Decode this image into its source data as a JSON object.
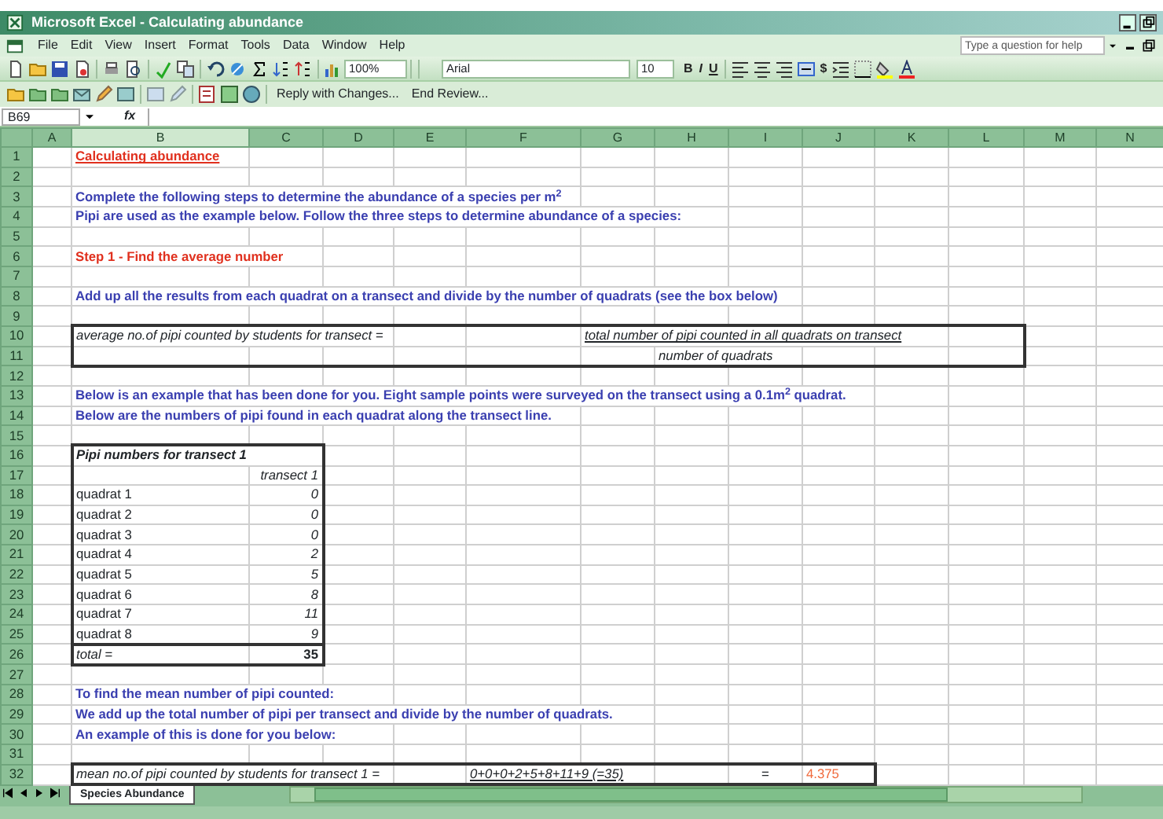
{
  "window": {
    "title": "Microsoft Excel - Calculating abundance"
  },
  "menu": [
    "File",
    "Edit",
    "View",
    "Insert",
    "Format",
    "Tools",
    "Data",
    "Window",
    "Help"
  ],
  "help_box": {
    "placeholder": "Type a question for help"
  },
  "toolbar": {
    "zoom": "100%",
    "font": "Arial",
    "font_size": "10",
    "bold_key": "B",
    "italic_key": "I",
    "underline_key": "U",
    "currency_key": "$"
  },
  "review_toolbar": {
    "reply": "Reply with Changes...",
    "end_review": "End Review..."
  },
  "formula_bar": {
    "name_box": "B69",
    "function_key": "fx"
  },
  "columns": [
    {
      "label": "A",
      "selected": false
    },
    {
      "label": "B",
      "selected": true
    },
    {
      "label": "C",
      "selected": false
    },
    {
      "label": "D",
      "selected": false
    },
    {
      "label": "E",
      "selected": false
    },
    {
      "label": "F",
      "selected": false
    },
    {
      "label": "G",
      "selected": false
    },
    {
      "label": "H",
      "selected": false
    },
    {
      "label": "I",
      "selected": false
    },
    {
      "label": "J",
      "selected": false
    },
    {
      "label": "K",
      "selected": false
    },
    {
      "label": "L",
      "selected": false
    },
    {
      "label": "M",
      "selected": false
    },
    {
      "label": "N",
      "selected": false
    }
  ],
  "rows": [
    {
      "number": "1",
      "cells": {
        "B": {
          "text": "Calculating abundance",
          "kind": "title"
        }
      }
    },
    {
      "number": "2",
      "cells": {}
    },
    {
      "number": "3",
      "cells": {
        "B": {
          "text": "Complete the following steps to determine the abundance of a species per m$^{2}$",
          "kind": "note"
        }
      }
    },
    {
      "number": "4",
      "cells": {
        "B": {
          "text": "Pipi are used as the example below.  Follow the three steps to determine abundance of a species:",
          "kind": "note"
        }
      }
    },
    {
      "number": "5",
      "cells": {}
    },
    {
      "number": "6",
      "cells": {
        "B": {
          "text": "Step 1 - Find the average number",
          "kind": "step"
        }
      }
    },
    {
      "number": "7",
      "cells": {}
    },
    {
      "number": "8",
      "cells": {
        "B": {
          "text": "Add up all the results from each quadrat on a transect and divide by the number of quadrats (see the box below)",
          "kind": "note"
        }
      }
    },
    {
      "number": "9",
      "cells": {}
    },
    {
      "number": "10",
      "cells": {
        "B": {
          "text": "average no.of pipi counted by students for transect =",
          "kind": "italic"
        },
        "G": {
          "text": "total number of pipi counted in all quadrats on transect",
          "kind": "italic_underline"
        }
      }
    },
    {
      "number": "11",
      "cells": {
        "H": {
          "text": "number of quadrats",
          "kind": "italic"
        }
      }
    },
    {
      "number": "12",
      "cells": {}
    },
    {
      "number": "13",
      "cells": {
        "B": {
          "text": "Below is an example that has been done for you.  Eight sample points were surveyed on the transect using a 0.1m$^{2}$ quadrat.",
          "kind": "note"
        }
      }
    },
    {
      "number": "14",
      "cells": {
        "B": {
          "text": "Below are the numbers of pipi found in each quadrat along the transect line.",
          "kind": "note"
        }
      }
    },
    {
      "number": "15",
      "cells": {}
    },
    {
      "number": "16",
      "cells": {
        "B": {
          "text": "Pipi numbers for transect 1",
          "kind": "bold_italic"
        }
      }
    },
    {
      "number": "17",
      "cells": {
        "C": {
          "text": "transect 1",
          "kind": "number"
        }
      }
    },
    {
      "number": "18",
      "cells": {
        "B": {
          "text": "quadrat 1",
          "kind": "plain"
        },
        "C": {
          "text": "0",
          "kind": "number"
        }
      }
    },
    {
      "number": "19",
      "cells": {
        "B": {
          "text": "quadrat 2",
          "kind": "plain"
        },
        "C": {
          "text": "0",
          "kind": "number"
        }
      }
    },
    {
      "number": "20",
      "cells": {
        "B": {
          "text": "quadrat 3",
          "kind": "plain"
        },
        "C": {
          "text": "0",
          "kind": "number"
        }
      }
    },
    {
      "number": "21",
      "cells": {
        "B": {
          "text": "quadrat 4",
          "kind": "plain"
        },
        "C": {
          "text": "2",
          "kind": "number"
        }
      }
    },
    {
      "number": "22",
      "cells": {
        "B": {
          "text": "quadrat 5",
          "kind": "plain"
        },
        "C": {
          "text": "5",
          "kind": "number"
        }
      }
    },
    {
      "number": "23",
      "cells": {
        "B": {
          "text": "quadrat 6",
          "kind": "plain"
        },
        "C": {
          "text": "8",
          "kind": "number"
        }
      }
    },
    {
      "number": "24",
      "cells": {
        "B": {
          "text": "quadrat 7",
          "kind": "plain"
        },
        "C": {
          "text": "11",
          "kind": "number"
        }
      }
    },
    {
      "number": "25",
      "cells": {
        "B": {
          "text": "quadrat 8",
          "kind": "plain"
        },
        "C": {
          "text": "9",
          "kind": "number"
        }
      }
    },
    {
      "number": "26",
      "cells": {
        "B": {
          "text": "total =",
          "kind": "italic"
        },
        "C": {
          "text": "35",
          "kind": "total"
        }
      }
    },
    {
      "number": "27",
      "cells": {}
    },
    {
      "number": "28",
      "cells": {
        "B": {
          "text": "To find the mean number of pipi counted:",
          "kind": "note"
        }
      }
    },
    {
      "number": "29",
      "cells": {
        "B": {
          "text": "We add up the total number of pipi per transect and divide by the number of quadrats.",
          "kind": "note"
        }
      }
    },
    {
      "number": "30",
      "cells": {
        "B": {
          "text": "An example of this is done for you below:",
          "kind": "note"
        }
      }
    },
    {
      "number": "31",
      "cells": {}
    },
    {
      "number": "32",
      "cells": {
        "B": {
          "text": "mean no.of pipi counted by students for transect 1 =",
          "kind": "italic"
        },
        "F": {
          "text": "0+0+0+2+5+8+11+9 (=35)",
          "kind": "italic_underline"
        },
        "I": {
          "text": "=",
          "kind": "center"
        },
        "J": {
          "text": "4.375",
          "kind": "result"
        }
      }
    }
  ],
  "sheet_tabs": [
    {
      "label": "Species Abundance",
      "selected": true
    }
  ]
}
